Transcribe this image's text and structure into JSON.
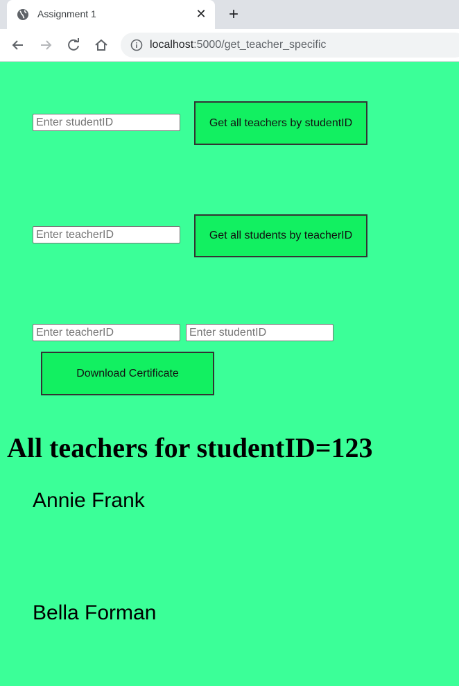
{
  "browser": {
    "tab_title": "Assignment 1",
    "url_host": "localhost",
    "url_path": ":5000/get_teacher_specific"
  },
  "forms": {
    "by_student": {
      "placeholder": "Enter studentID",
      "button_label": "Get all teachers by studentID"
    },
    "by_teacher": {
      "placeholder": "Enter teacherID",
      "button_label": "Get all students by teacherID"
    },
    "certificate": {
      "teacher_placeholder": "Enter teacherID",
      "student_placeholder": "Enter studentID",
      "button_label": "Download Certificate"
    }
  },
  "result": {
    "heading": "All teachers for studentID=123",
    "teachers": [
      "Annie Frank",
      "Bella Forman"
    ]
  },
  "colors": {
    "page_background": "#3bff98",
    "button_background": "#12f061"
  }
}
